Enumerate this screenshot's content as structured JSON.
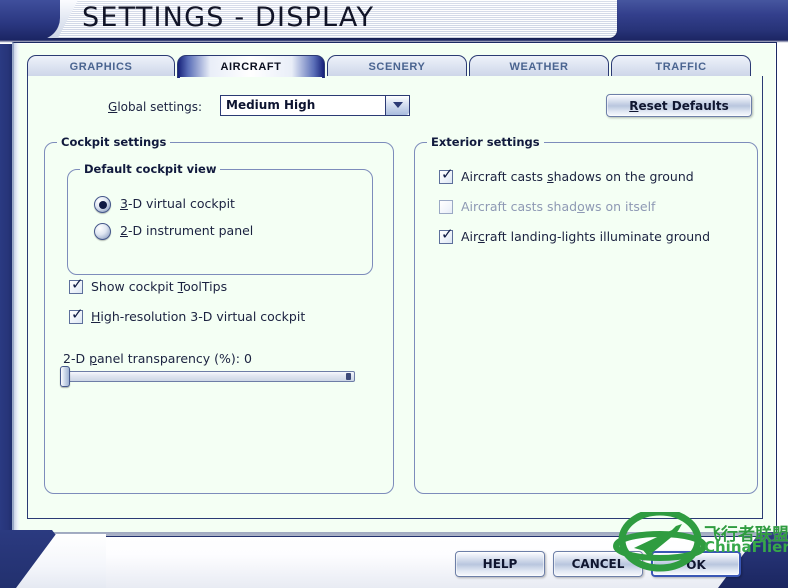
{
  "window": {
    "title": "SETTINGS - DISPLAY",
    "background_cut_text": "ts"
  },
  "tabs": [
    {
      "label": "GRAPHICS",
      "active": false,
      "name": "tab-graphics"
    },
    {
      "label": "AIRCRAFT",
      "active": true,
      "name": "tab-aircraft"
    },
    {
      "label": "SCENERY",
      "active": false,
      "name": "tab-scenery"
    },
    {
      "label": "WEATHER",
      "active": false,
      "name": "tab-weather"
    },
    {
      "label": "TRAFFIC",
      "active": false,
      "name": "tab-traffic"
    }
  ],
  "global_settings": {
    "label_pre": "G",
    "label_post": "lobal settings:",
    "value": "Medium High",
    "dropdown_icon": "chevron-down-icon"
  },
  "reset_button": {
    "accel": "R",
    "rest": "eset Defaults"
  },
  "cockpit_settings": {
    "title": "Cockpit settings",
    "default_view": {
      "title": "Default cockpit view",
      "options": [
        {
          "accel": "3",
          "rest": "-D virtual cockpit",
          "selected": true
        },
        {
          "accel": "2",
          "rest": "-D instrument panel",
          "selected": false
        }
      ]
    },
    "checkboxes": [
      {
        "pre": "Show cockpit ",
        "accel": "T",
        "post": "oolTips",
        "checked": true,
        "disabled": false
      },
      {
        "pre": "",
        "accel": "H",
        "post": "igh-resolution 3-D virtual cockpit",
        "checked": true,
        "disabled": false
      }
    ],
    "slider": {
      "label_pre": "2-D ",
      "label_accel": "p",
      "label_post": "anel transparency (%): ",
      "value": "0",
      "min": 0,
      "max": 100,
      "current": 0
    }
  },
  "exterior_settings": {
    "title": "Exterior settings",
    "checkboxes": [
      {
        "pre": "Aircraft casts ",
        "accel": "s",
        "post": "hadows on the ground",
        "checked": true,
        "disabled": false
      },
      {
        "pre": "Aircraft casts shad",
        "accel": "o",
        "post": "ws on itself",
        "checked": false,
        "disabled": true
      },
      {
        "pre": "Air",
        "accel": "c",
        "post": "raft landing-lights illuminate ground",
        "checked": true,
        "disabled": false
      }
    ]
  },
  "footer_buttons": [
    {
      "label": "HELP",
      "name": "help-button",
      "default": false
    },
    {
      "label": "CANCEL",
      "name": "cancel-button",
      "default": false
    },
    {
      "label": "OK",
      "name": "ok-button",
      "default": true
    }
  ],
  "watermark": {
    "chinese": "飞行者联盟",
    "english": "ChinaFlier",
    "logo_icon": "airplane-in-circle-logo",
    "color": "#2f9c40"
  },
  "colors": {
    "titlebar_blue": "#27357b",
    "panel_bg": "#f4fff4",
    "border_navy": "#2b3a74",
    "tab_text": "#4a6490",
    "accent_green": "#2f9c40"
  }
}
